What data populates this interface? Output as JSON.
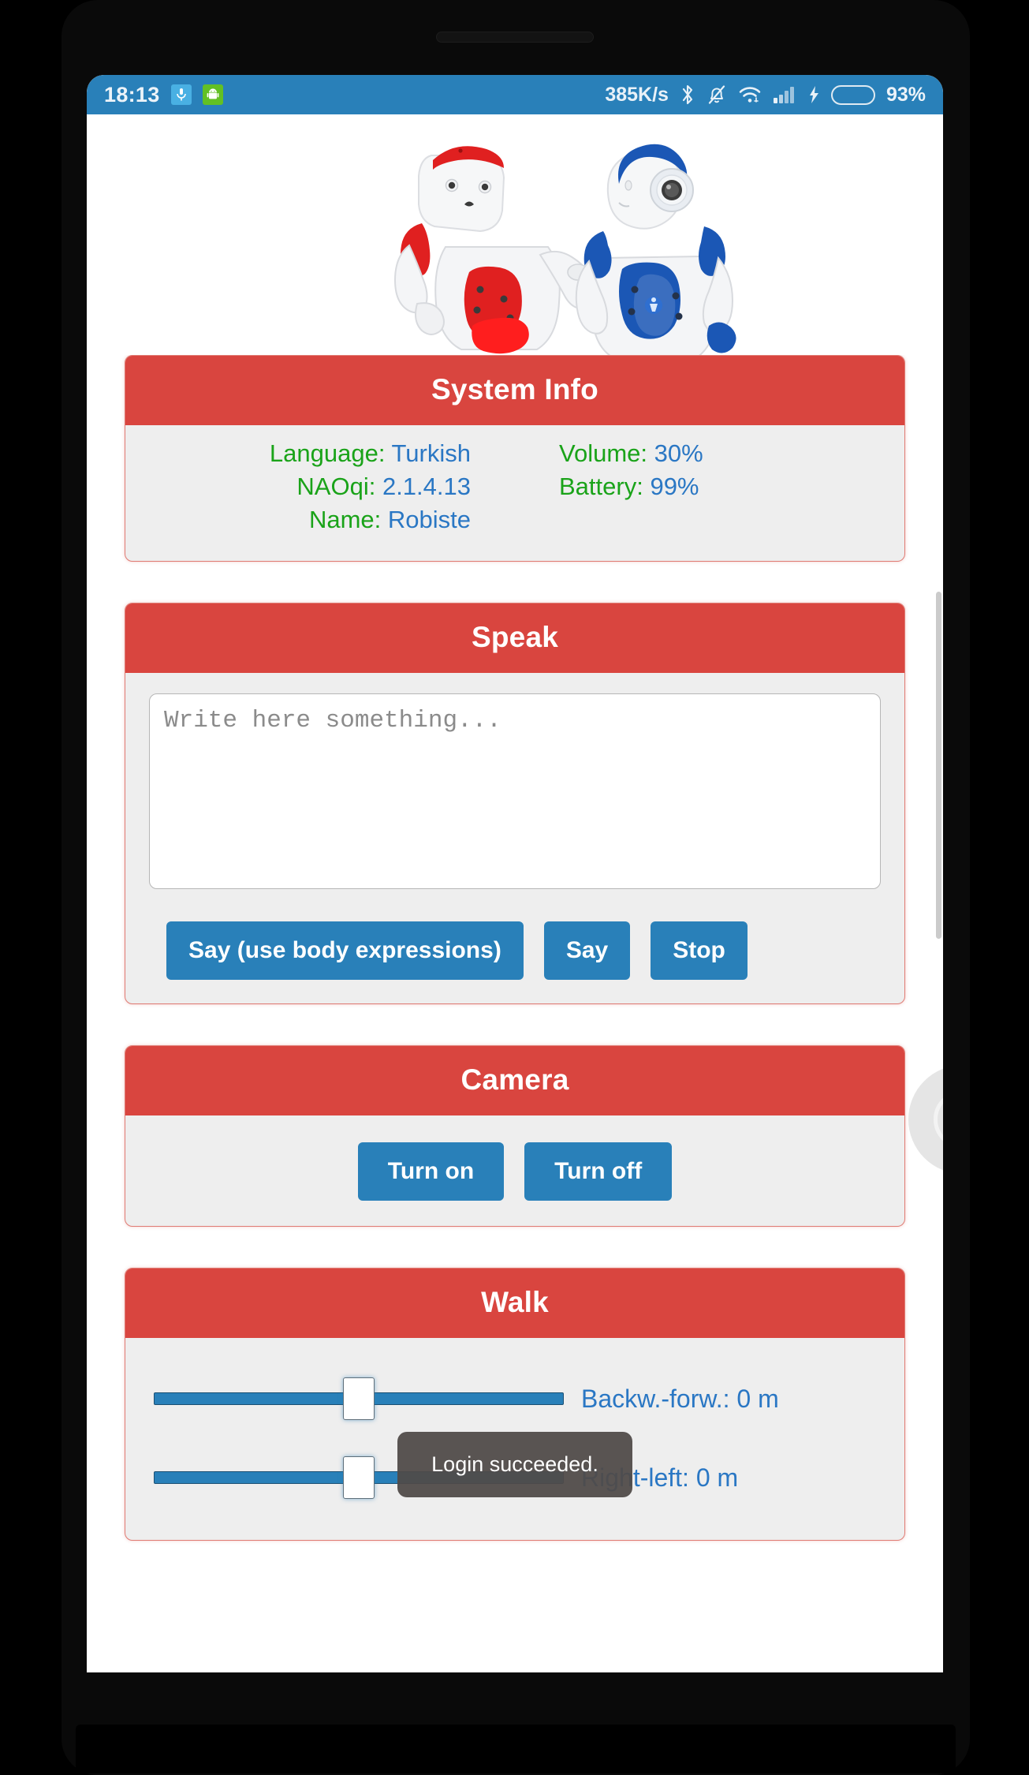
{
  "status_bar": {
    "clock": "18:13",
    "mic_badge_icon": "microphone-icon",
    "android_badge_icon": "android-robot-icon",
    "net_speed": "385K/s",
    "bluetooth_icon": "bluetooth-icon",
    "bell_muted_icon": "bell-muted-icon",
    "wifi_icon": "wifi-icon",
    "signal_icon": "cellular-signal-icon",
    "charging_icon": "charging-bolt-icon",
    "battery_percent": "93%",
    "battery_level": 93,
    "bar_color": "#2980b9",
    "battery_fill_color": "#4cd519"
  },
  "banner": {
    "name": "nao-robots-banner",
    "robot_left_color": "#e02020",
    "robot_right_color": "#1b57b5",
    "body_color": "#f2f3f5"
  },
  "theme": {
    "header_red": "#d9453f",
    "card_body_gray": "#eeeeee",
    "button_blue": "#2980b9",
    "label_green": "#1aa319",
    "value_blue": "#2a77c4"
  },
  "cards": {
    "system_info": {
      "title": "System Info",
      "left_rows": [
        {
          "label": "Language:",
          "value": "Turkish"
        },
        {
          "label": "NAOqi:",
          "value": "2.1.4.13"
        },
        {
          "label": "Name:",
          "value": "Robiste"
        }
      ],
      "right_rows": [
        {
          "label": "Volume:",
          "value": "30%"
        },
        {
          "label": "Battery:",
          "value": "99%"
        }
      ]
    },
    "speak": {
      "title": "Speak",
      "input_value": "",
      "input_placeholder": "Write here something...",
      "buttons": [
        "Say (use body expressions)",
        "Say",
        "Stop"
      ]
    },
    "camera": {
      "title": "Camera",
      "buttons": [
        "Turn on",
        "Turn off"
      ]
    },
    "walk": {
      "title": "Walk",
      "sliders": [
        {
          "label": "Backw.-forw.: 0 m",
          "value": 0,
          "position_percent": 50
        },
        {
          "label": "Right-left: 0 m",
          "value": 0,
          "position_percent": 50
        }
      ]
    }
  },
  "toast": {
    "message": "Login succeeded."
  },
  "fab": {
    "name": "floating-assistive-touch-button"
  }
}
